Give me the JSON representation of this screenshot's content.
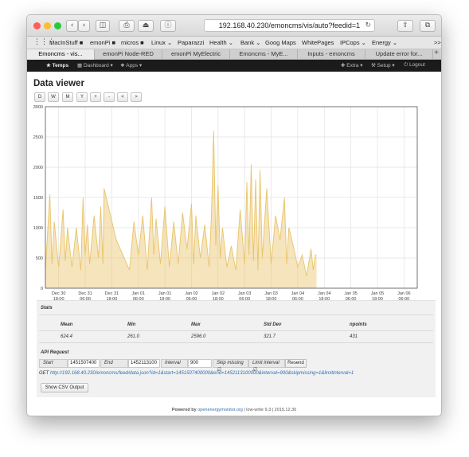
{
  "browser": {
    "url": "192.168.40.230/emoncms/vis/auto?feedid=1",
    "bookmarks": [
      "MacInStuff ■",
      "emonPi ■",
      "micros ■",
      "Linux ⌄",
      "Paparazzi",
      "Health ⌄",
      "Bank ⌄",
      "Goog Maps",
      "WhitePages",
      "IPCops ⌄",
      "Energy ⌄"
    ],
    "bookmarks_more": ">>",
    "tabs": [
      "Emoncms - vis...",
      "emonPi Node-RED",
      "emonPi MyElectric",
      "Emoncms - MyE...",
      "Inputs - emoncms",
      "Update error for..."
    ],
    "active_tab": 0,
    "colors": {
      "close": "#fc5f57",
      "minimize": "#fdbc2e",
      "zoom": "#28c840"
    }
  },
  "nav": {
    "temps": "★ Temps",
    "dashboard": "▦ Dashboard ▾",
    "apps": "❖ Apps ▾",
    "extra": "✚ Extra ▾",
    "setup": "⚒ Setup ▾",
    "logout": "⏻ Logout"
  },
  "page": {
    "title": "Data viewer",
    "zoom_buttons": [
      "D",
      "W",
      "M",
      "Y",
      "+",
      "-",
      "<",
      ">"
    ]
  },
  "chart_data": {
    "type": "area",
    "title": "",
    "xlabel": "",
    "ylabel": "",
    "ylim": [
      0,
      3000
    ],
    "yticks": [
      0,
      500,
      1000,
      1500,
      2000,
      2500,
      3000
    ],
    "xlim": [
      "Dec 30 12:00",
      "Jan 06 12:00"
    ],
    "xtick_labels": [
      [
        "Dec 30",
        "18:00"
      ],
      [
        "Dec 31",
        "06:00"
      ],
      [
        "Dec 31",
        "18:00"
      ],
      [
        "Jan 01",
        "06:00"
      ],
      [
        "Jan 01",
        "18:00"
      ],
      [
        "Jan 02",
        "06:00"
      ],
      [
        "Jan 02",
        "18:00"
      ],
      [
        "Jan 03",
        "06:00"
      ],
      [
        "Jan 03",
        "18:00"
      ],
      [
        "Jan 04",
        "06:00"
      ],
      [
        "Jan 04",
        "18:00"
      ],
      [
        "Jan 05",
        "06:00"
      ],
      [
        "Jan 05",
        "18:00"
      ],
      [
        "Jan 06",
        "06:00"
      ]
    ],
    "series": [
      {
        "color": "#e9c46a",
        "x": [
          "Dec 30 12:00",
          "Dec 30 14:00",
          "Dec 30 15:00",
          "Dec 30 16:00",
          "Dec 30 18:00",
          "Dec 30 20:00",
          "Dec 30 21:00",
          "Dec 30 22:00",
          "Dec 31 00:00",
          "Dec 31 02:00",
          "Dec 31 04:00",
          "Dec 31 05:00",
          "Dec 31 06:00",
          "Dec 31 07:00",
          "Dec 31 08:00",
          "Dec 31 10:00",
          "Dec 31 12:00",
          "Dec 31 13:00",
          "Dec 31 14:00",
          "Dec 31 14:30",
          "Dec 31 20:00",
          "Jan 01 02:00",
          "Jan 01 04:00",
          "Jan 01 06:00",
          "Jan 01 08:00",
          "Jan 01 10:00",
          "Jan 01 12:00",
          "Jan 01 13:00",
          "Jan 01 14:00",
          "Jan 01 16:00",
          "Jan 01 18:00",
          "Jan 01 20:00",
          "Jan 01 22:00",
          "Jan 02 00:00",
          "Jan 02 02:00",
          "Jan 02 04:00",
          "Jan 02 06:00",
          "Jan 02 07:00",
          "Jan 02 08:00",
          "Jan 02 10:00",
          "Jan 02 12:00",
          "Jan 02 14:00",
          "Jan 02 15:00",
          "Jan 02 16:00",
          "Jan 02 17:00",
          "Jan 02 18:00",
          "Jan 02 19:00",
          "Jan 02 20:00",
          "Jan 02 22:00",
          "Jan 03 00:00",
          "Jan 03 02:00",
          "Jan 03 04:00",
          "Jan 03 06:00",
          "Jan 03 07:00",
          "Jan 03 08:00",
          "Jan 03 09:00",
          "Jan 03 10:00",
          "Jan 03 11:00",
          "Jan 03 12:00",
          "Jan 03 13:00",
          "Jan 03 14:00",
          "Jan 03 16:00",
          "Jan 03 18:00",
          "Jan 03 20:00",
          "Jan 03 22:00",
          "Jan 04 00:00",
          "Jan 04 01:00",
          "Jan 04 02:00",
          "Jan 04 04:00",
          "Jan 04 06:00",
          "Jan 04 08:00",
          "Jan 04 10:00",
          "Jan 04 12:00",
          "Jan 04 13:00",
          "Jan 04 14:00",
          "Jan 04 14:30"
        ],
        "y": [
          300,
          1550,
          400,
          1100,
          350,
          1300,
          450,
          1000,
          350,
          1000,
          300,
          1500,
          550,
          1050,
          400,
          1200,
          500,
          1350,
          400,
          1650,
          800,
          300,
          1100,
          550,
          1200,
          300,
          1500,
          550,
          1150,
          400,
          1350,
          350,
          1100,
          400,
          1250,
          650,
          1400,
          400,
          1200,
          500,
          1050,
          350,
          1200,
          2600,
          700,
          1700,
          500,
          1000,
          350,
          700,
          300,
          1300,
          400,
          1750,
          550,
          2050,
          450,
          1800,
          300,
          1950,
          500,
          1650,
          400,
          1200,
          800,
          1500,
          400,
          1000,
          700,
          350,
          550,
          200,
          650,
          300,
          550,
          550
        ]
      }
    ]
  },
  "stats": {
    "title": "Stats",
    "headers": [
      "Mean",
      "Min",
      "Max",
      "Std Dev",
      "npoints"
    ],
    "values": [
      "624.4",
      "261.0",
      "2596.0",
      "321.7",
      "431"
    ]
  },
  "api": {
    "title": "API Request",
    "start_label": "Start",
    "start_value": "1451507400",
    "end_label": "End",
    "end_value": "1452113100",
    "interval_label": "Interval",
    "interval_value": "900",
    "skip_label": "Skip missing",
    "limit_label": "Limit interval",
    "resend_label": "Resend",
    "get_prefix": "GET",
    "get_url": "http://192.168.40.230/emoncms/feed/data.json?id=1&start=1451507400000&end=1452113100000&interval=900&skipmissing=1&limitinterval=1",
    "csv_label": "Show CSV Output"
  },
  "footer": {
    "prefix": "Powered by",
    "link": "openenergymonitor.org",
    "suffix": "| low-write 9.3 | 2015.12.30"
  }
}
